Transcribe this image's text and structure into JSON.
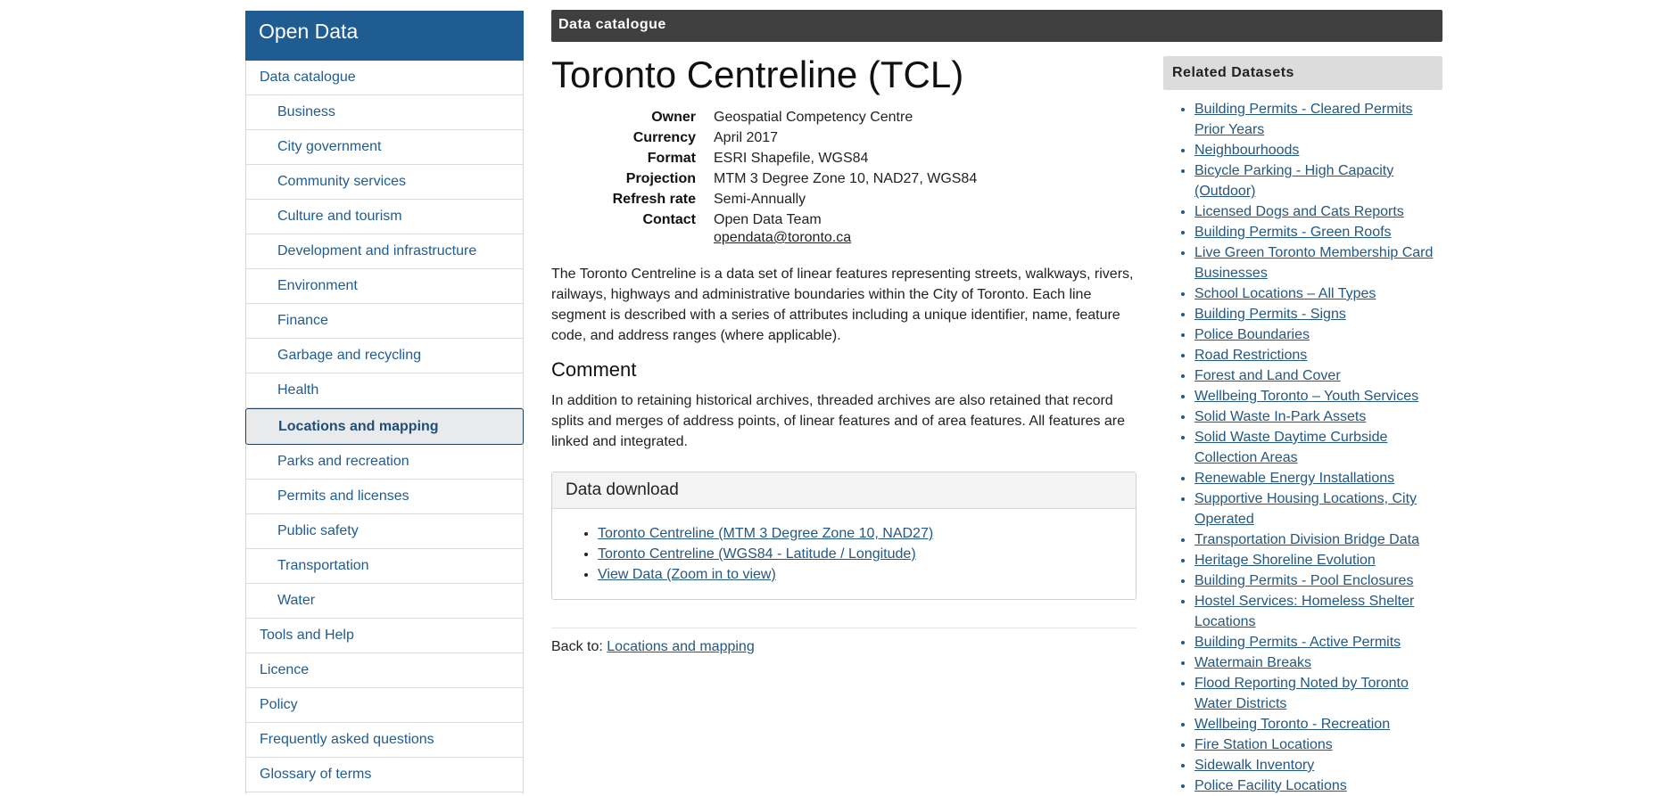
{
  "sidebar": {
    "title": "Open Data",
    "items": [
      {
        "label": "Data catalogue",
        "level": 0,
        "active": false
      },
      {
        "label": "Business",
        "level": 1,
        "active": false
      },
      {
        "label": "City government",
        "level": 1,
        "active": false
      },
      {
        "label": "Community services",
        "level": 1,
        "active": false
      },
      {
        "label": "Culture and tourism",
        "level": 1,
        "active": false
      },
      {
        "label": "Development and infrastructure",
        "level": 1,
        "active": false
      },
      {
        "label": "Environment",
        "level": 1,
        "active": false
      },
      {
        "label": "Finance",
        "level": 1,
        "active": false
      },
      {
        "label": "Garbage and recycling",
        "level": 1,
        "active": false
      },
      {
        "label": "Health",
        "level": 1,
        "active": false
      },
      {
        "label": "Locations and mapping",
        "level": 1,
        "active": true
      },
      {
        "label": "Parks and recreation",
        "level": 1,
        "active": false
      },
      {
        "label": "Permits and licenses",
        "level": 1,
        "active": false
      },
      {
        "label": "Public safety",
        "level": 1,
        "active": false
      },
      {
        "label": "Transportation",
        "level": 1,
        "active": false
      },
      {
        "label": "Water",
        "level": 1,
        "active": false
      },
      {
        "label": "Tools and Help",
        "level": 0,
        "active": false
      },
      {
        "label": "Licence",
        "level": 0,
        "active": false
      },
      {
        "label": "Policy",
        "level": 0,
        "active": false
      },
      {
        "label": "Frequently asked questions",
        "level": 0,
        "active": false
      },
      {
        "label": "Glossary of terms",
        "level": 0,
        "active": false
      }
    ]
  },
  "topbar": {
    "title": "Data catalogue"
  },
  "main": {
    "title": "Toronto Centreline (TCL)",
    "meta": [
      {
        "key": "Owner",
        "value": "Geospatial Competency Centre"
      },
      {
        "key": "Currency",
        "value": "April 2017"
      },
      {
        "key": "Format",
        "value": "ESRI Shapefile, WGS84"
      },
      {
        "key": "Projection",
        "value": "MTM 3 Degree Zone 10, NAD27, WGS84"
      },
      {
        "key": "Refresh rate",
        "value": "Semi-Annually"
      },
      {
        "key": "Contact",
        "value": "Open Data Team"
      }
    ],
    "contact_email": "opendata@toronto.ca",
    "description": "The Toronto Centreline is a data set of linear features representing streets, walkways, rivers, railways, highways and administrative boundaries within the City of Toronto. Each line segment is described with a series of attributes including a unique identifier, name, feature code, and address ranges (where applicable).",
    "comment_heading": "Comment",
    "comment": "In addition to retaining historical archives, threaded archives are also retained that record splits and merges of address points, of linear features and of area features. All features are linked and integrated.",
    "download": {
      "heading": "Data download",
      "links": [
        "Toronto Centreline (MTM 3 Degree Zone 10, NAD27)",
        "Toronto Centreline (WGS84 - Latitude / Longitude)",
        "View Data (Zoom in to view)"
      ]
    },
    "back_label": "Back to:",
    "back_link": "Locations and mapping"
  },
  "related": {
    "heading": "Related Datasets",
    "links": [
      "Building Permits - Cleared Permits Prior Years",
      "Neighbourhoods",
      "Bicycle Parking - High Capacity (Outdoor)",
      "Licensed Dogs and Cats Reports",
      "Building Permits - Green Roofs",
      "Live Green Toronto Membership Card Businesses",
      "School Locations – All Types",
      "Building Permits - Signs",
      "Police Boundaries",
      "Road Restrictions",
      "Forest and Land Cover",
      "Wellbeing Toronto – Youth Services",
      "Solid Waste In-Park Assets",
      "Solid Waste Daytime Curbside Collection Areas",
      "Renewable Energy Installations",
      "Supportive Housing Locations, City Operated",
      "Transportation Division Bridge Data",
      "Heritage Shoreline Evolution",
      "Building Permits - Pool Enclosures",
      "Hostel Services: Homeless Shelter Locations",
      "Building Permits - Active Permits",
      "Watermain Breaks",
      "Flood Reporting Noted by Toronto Water Districts",
      "Wellbeing Toronto - Recreation",
      "Fire Station Locations",
      "Sidewalk Inventory",
      "Police Facility Locations"
    ]
  }
}
